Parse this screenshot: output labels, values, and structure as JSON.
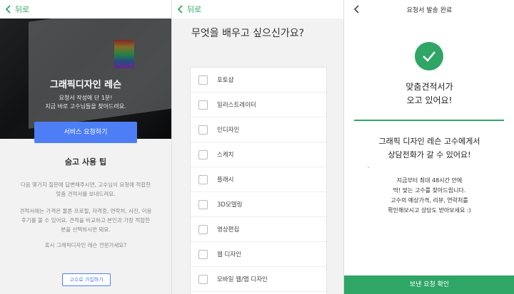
{
  "colors": {
    "brand_green": "#2fa566",
    "button_blue": "#4d7ef5"
  },
  "panel1": {
    "back_label": "뒤로",
    "hero": {
      "title": "그래픽디자인 레슨",
      "sub_line1": "요청서 작성에 단 1분!",
      "sub_line2": "지금 바로 고수님들을 찾아드려요."
    },
    "service_button": "서비스 요청하기",
    "tips_title": "숨고 사용 팁",
    "tips": {
      "p1_l1": "다음 몇가지 질문에 답변해주시면, 고수님이 요청에 적합한",
      "p1_l2": "맞춤 견적서를 보내드려요.",
      "p2_l1": "견적서에는 가격은 물론 프로필, 자격증, 연락처, 사진, 이용",
      "p2_l2": "후기를 볼 수 있어요. 견적을 비교하고 본인과 가장 적합한",
      "p2_l3": "분을 선택하시면 돼요.",
      "p3": "혹시 그래픽디자인 레슨 전문가세요?"
    },
    "join_button": "고수로 가입하기"
  },
  "panel2": {
    "back_label": "뒤로",
    "question": "무엇을 배우고 싶으신가요?",
    "options": [
      "포토샵",
      "일러스트레이터",
      "인디자인",
      "스케치",
      "플래시",
      "3D모델링",
      "영상편집",
      "웹 디자인",
      "모바일 웹/앱 디자인"
    ]
  },
  "panel3": {
    "title": "요청서 발송 완료",
    "headline1": "맞춤견적서가",
    "headline2": "오고 있어요!",
    "sub1": "그래픽 디자인 레슨 고수에게서",
    "sub2": "상담전화가 갈 수 있어요!",
    "body": {
      "l1": "지금부터 최대 48시간 안에",
      "l2": "딱! 맞는 고수를 찾아드립니다.",
      "l3": "고수의 예상가격, 리뷰, 연락처를",
      "l4": "확인해보시고 상담도 받아보세요 :)"
    },
    "confirm_button": "보낸 요청 확인"
  }
}
